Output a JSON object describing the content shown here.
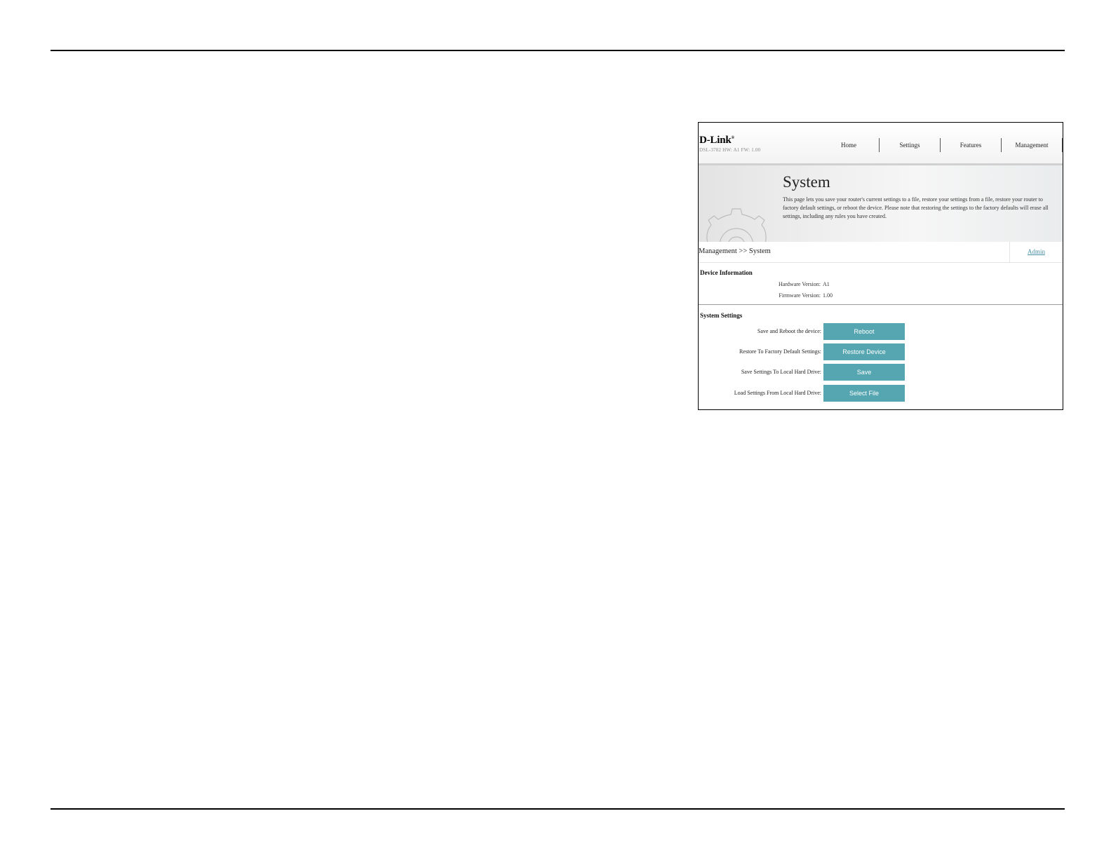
{
  "router": {
    "logo": "D-Link",
    "logo_mark": "®",
    "model": "DSL-3782  HW: A1  FW: 1.00",
    "nav": [
      {
        "label": "Home"
      },
      {
        "label": "Settings"
      },
      {
        "label": "Features"
      },
      {
        "label": "Management"
      }
    ],
    "page_title": "System",
    "page_description": "This page lets you save your router's current settings to a file, restore your settings from a file, restore your router to factory default settings, or reboot the device. Please note that restoring the settings to the factory defaults will erase all settings, including any rules you have created.",
    "breadcrumb": "Management >> System",
    "admin_link": "Admin",
    "device_info": {
      "title": "Device Information",
      "hardware_label": "Hardware Version:",
      "hardware_value": "A1",
      "firmware_label": "Firmware Version:",
      "firmware_value": "1.00"
    },
    "system_settings": {
      "title": "System Settings",
      "rows": [
        {
          "label": "Save and Reboot the device:",
          "button": "Reboot"
        },
        {
          "label": "Restore To Factory Default Settings:",
          "button": "Restore Device"
        },
        {
          "label": "Save Settings To Local Hard Drive:",
          "button": "Save"
        },
        {
          "label": "Load Settings From Local Hard Drive:",
          "button": "Select File"
        }
      ]
    },
    "colors": {
      "button": "#56a6b1",
      "link": "#4a90a4"
    }
  }
}
